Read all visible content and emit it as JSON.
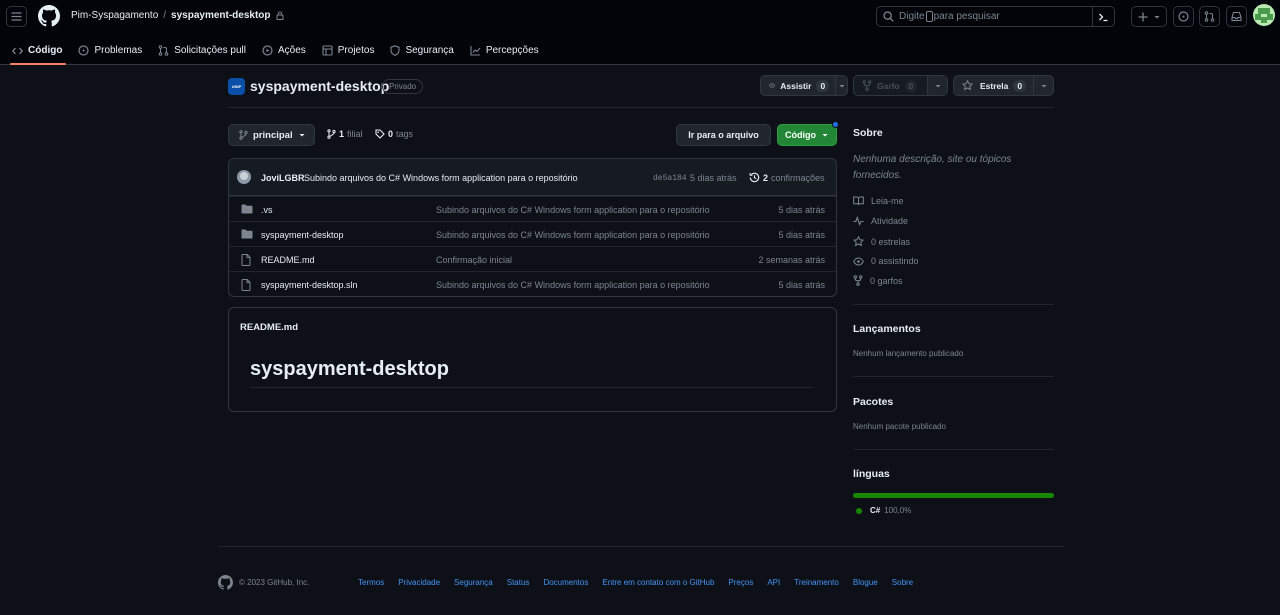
{
  "header": {
    "owner": "Pim-Syspagamento",
    "separator": "/",
    "repo": "syspayment-desktop",
    "search_placeholder_a": "Digite",
    "search_placeholder_b": "para pesquisar"
  },
  "nav": {
    "tabs": [
      {
        "label": "Código",
        "icon": "code-icon"
      },
      {
        "label": "Problemas",
        "icon": "issue-icon"
      },
      {
        "label": "Solicitações pull",
        "icon": "pull-request-icon"
      },
      {
        "label": "Ações",
        "icon": "play-icon"
      },
      {
        "label": "Projetos",
        "icon": "table-icon"
      },
      {
        "label": "Segurança",
        "icon": "shield-icon"
      },
      {
        "label": "Percepções",
        "icon": "graph-icon"
      }
    ]
  },
  "repo": {
    "icon_text": "UNIP",
    "name": "syspayment-desktop",
    "visibility": "Privado",
    "watch_label": "Assistir",
    "watch_count": "0",
    "fork_label": "Garfo",
    "fork_count": "0",
    "star_label": "Estrela",
    "star_count": "0"
  },
  "branch": {
    "name": "principal",
    "branches_count": "1",
    "branches_label": "filial",
    "tags_count": "0",
    "tags_label": "tags",
    "goto_file": "Ir para o arquivo",
    "code_label": "Código"
  },
  "commit": {
    "author": "JoviLGBR",
    "message": "Subindo arquivos do C# Windows form application para o repositório",
    "sha": "de5a184",
    "time": "5 dias atrás",
    "count": "2",
    "count_label": "confirmações"
  },
  "files": [
    {
      "type": "folder",
      "name": ".vs",
      "message": "Subindo arquivos do C# Windows form application para o repositório",
      "time": "5 dias atrás"
    },
    {
      "type": "folder",
      "name": "syspayment-desktop",
      "message": "Subindo arquivos do C# Windows form application para o repositório",
      "time": "5 dias atrás"
    },
    {
      "type": "file",
      "name": "README.md",
      "message": "Confirmação inicial",
      "time": "2 semanas atrás"
    },
    {
      "type": "file",
      "name": "syspayment-desktop.sln",
      "message": "Subindo arquivos do C# Windows form application para o repositório",
      "time": "5 dias atrás"
    }
  ],
  "readme": {
    "title": "README.md",
    "heading": "syspayment-desktop"
  },
  "sidebar": {
    "about_title": "Sobre",
    "about_desc": "Nenhuma descrição, site ou tópicos fornecidos.",
    "links": [
      {
        "label": "Leia-me",
        "icon": "book-icon"
      },
      {
        "label": "Atividade",
        "icon": "pulse-icon"
      },
      {
        "label": "0 estrelas",
        "icon": "star-icon"
      },
      {
        "label": "0 assistindo",
        "icon": "eye-icon"
      },
      {
        "label": "0 garfos",
        "icon": "fork-icon"
      }
    ],
    "releases_title": "Lançamentos",
    "releases_desc": "Nenhum lançamento publicado",
    "packages_title": "Pacotes",
    "packages_desc": "Nenhum pacote publicado",
    "languages_title": "línguas",
    "languages": [
      {
        "name": "C#",
        "percent": "100,0%",
        "share": 100,
        "color": "#178600"
      }
    ]
  },
  "footer": {
    "copyright": "© 2023 GitHub, Inc.",
    "links": [
      "Termos",
      "Privacidade",
      "Segurança",
      "Status",
      "Documentos",
      "Entre em contato com o GitHub",
      "Preços",
      "API",
      "Treinamento",
      "Blogue",
      "Sobre"
    ]
  },
  "colors": {
    "accent_green": "#238636",
    "tab_underline": "#f78166",
    "link_blue": "#4493f8",
    "csharp": "#178600"
  }
}
